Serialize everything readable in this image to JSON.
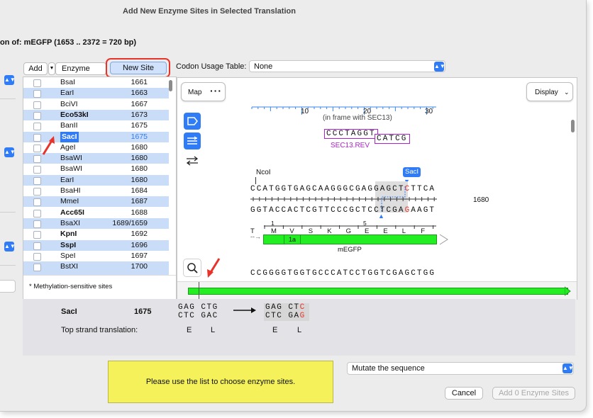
{
  "dialog": {
    "title": "Add New Enzyme Sites in Selected Translation",
    "subtitle": "on of:  mEGFP  (1653 .. 2372 = 720 bp)"
  },
  "list_header": {
    "add_label": "Add",
    "enzyme_label": "Enzyme",
    "new_site_label": "New Site"
  },
  "enzymes": [
    {
      "name": "BsaI",
      "pos": "1661",
      "bold": false
    },
    {
      "name": "EarI",
      "pos": "1663",
      "bold": false
    },
    {
      "name": "BciVI",
      "pos": "1667",
      "bold": false
    },
    {
      "name": "Eco53kI",
      "pos": "1673",
      "bold": true
    },
    {
      "name": "BanII",
      "pos": "1675",
      "bold": false
    },
    {
      "name": "SacI",
      "pos": "1675",
      "bold": true,
      "selected": true
    },
    {
      "name": "AgeI",
      "pos": "1680",
      "bold": false
    },
    {
      "name": "BsaWI",
      "pos": "1680",
      "bold": false
    },
    {
      "name": "BsaWI",
      "pos": "1680",
      "bold": false
    },
    {
      "name": "EarI",
      "pos": "1680",
      "bold": false
    },
    {
      "name": "BsaHI",
      "pos": "1684",
      "bold": false
    },
    {
      "name": "MmeI",
      "pos": "1687",
      "bold": false
    },
    {
      "name": "Acc65I",
      "pos": "1688",
      "bold": true
    },
    {
      "name": "BsaXI",
      "pos": "1689/1659",
      "bold": false
    },
    {
      "name": "KpnI",
      "pos": "1692",
      "bold": true
    },
    {
      "name": "SspI",
      "pos": "1696",
      "bold": true
    },
    {
      "name": "SpeI",
      "pos": "1697",
      "bold": false
    },
    {
      "name": "BstXI",
      "pos": "1700",
      "bold": false
    }
  ],
  "methylation_note": "* Methylation-sensitive sites",
  "codon": {
    "label": "Codon Usage Table:",
    "value": "None"
  },
  "map": {
    "map_button": "Map",
    "more_icon": "ellipsis",
    "display_button": "Display",
    "ruler_ticks": [
      "10",
      "20",
      "30"
    ],
    "frame_note": "(in frame with SEC13)",
    "primer_seq": "CCCTAGGT",
    "primer_seq2": "CATCG",
    "primer_name": "SEC13.REV",
    "ncoi_label": "NcoI",
    "saci_label": "SacI",
    "top_strand": "CCATGGTGAGCAAGGGCGAGGAGCTCTTCA",
    "bottom_strand": "GGTACCACTCGTTCCCGCTCCTCGAGAAGT",
    "position_label": "1680",
    "aa_frame_num": "1",
    "aa_num_5": "5",
    "amino_acids": [
      "T",
      "M",
      "V",
      "S",
      "K",
      "G",
      "E",
      "E",
      "L",
      "F"
    ],
    "feature_tag": "1a",
    "feature_name": "mEGFP",
    "next_seq": "CCGGGGTGGTGCCCATCCTGGTCGAGCTGG"
  },
  "mutation": {
    "enzyme": "SacI",
    "position": "1675",
    "before_top": [
      "GAG",
      "CTG"
    ],
    "before_bottom": [
      "CTC",
      "GAC"
    ],
    "after_top": [
      "GAG",
      "CTC"
    ],
    "after_bottom": [
      "CTC",
      "GAG"
    ],
    "translation_label": "Top strand translation:",
    "translation_before": [
      "E",
      "L"
    ],
    "translation_after": [
      "E",
      "L"
    ]
  },
  "notice": "Please use the list to choose enzyme sites.",
  "mode": {
    "value": "Mutate the sequence"
  },
  "buttons": {
    "cancel": "Cancel",
    "confirm": "Add 0 Enzyme Sites"
  },
  "colors": {
    "accent": "#2f7cf6",
    "feature_green": "#22ee22",
    "primer_purple": "#b020d0",
    "highlight_red": "#e8332a",
    "notice_yellow": "#f4f15a"
  }
}
